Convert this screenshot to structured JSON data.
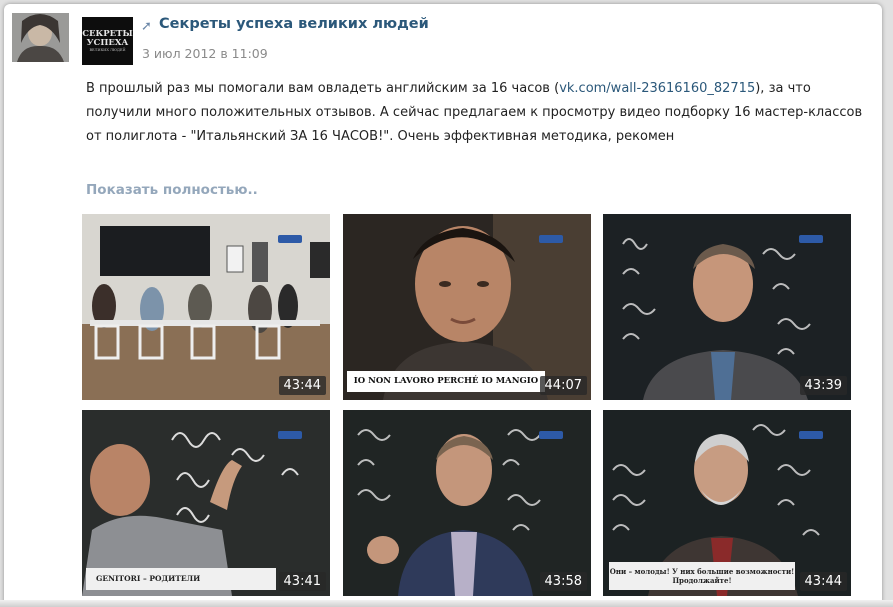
{
  "post": {
    "group_name": "Секреты успеха великих людей",
    "date": "3 июл 2012 в 11:09",
    "repost_icon": "repost-arrow-icon",
    "logo_lines": [
      "СЕКРЕТЫ",
      "УСПЕХА",
      "ВЕЛИКИХ ЛЮДЕЙ"
    ],
    "text_before_link": "В прошлый раз мы помогали вам овладеть английским за 16 часов (",
    "link": "vk.com/wall-23616160_82715",
    "text_after_link": "), за что получили много положительных отзывов. А сейчас предлагаем к просмотру видео подборку 16 мастер-классов от полиглота - \"Итальянский ЗА 16 ЧАСОВ!\". Очень эффективная методика, рекомен",
    "show_more": "Показать полностью.."
  },
  "videos": [
    {
      "duration": "43:44"
    },
    {
      "duration": "44:07",
      "subtitle": "IO NON LAVORO PERCHÉ IO MANGIO"
    },
    {
      "duration": "43:39"
    },
    {
      "duration": "43:41",
      "caption": "GENITORI – РОДИТЕЛИ"
    },
    {
      "duration": "43:58"
    },
    {
      "duration": "43:44",
      "caption": "Они – молоды! У них большие возможности! Продолжайте!"
    }
  ],
  "colors": {
    "link": "#2b587a",
    "muted": "#8a8a8a",
    "show_more": "#94a7bb",
    "duration_bg": "#2f2f2f"
  }
}
